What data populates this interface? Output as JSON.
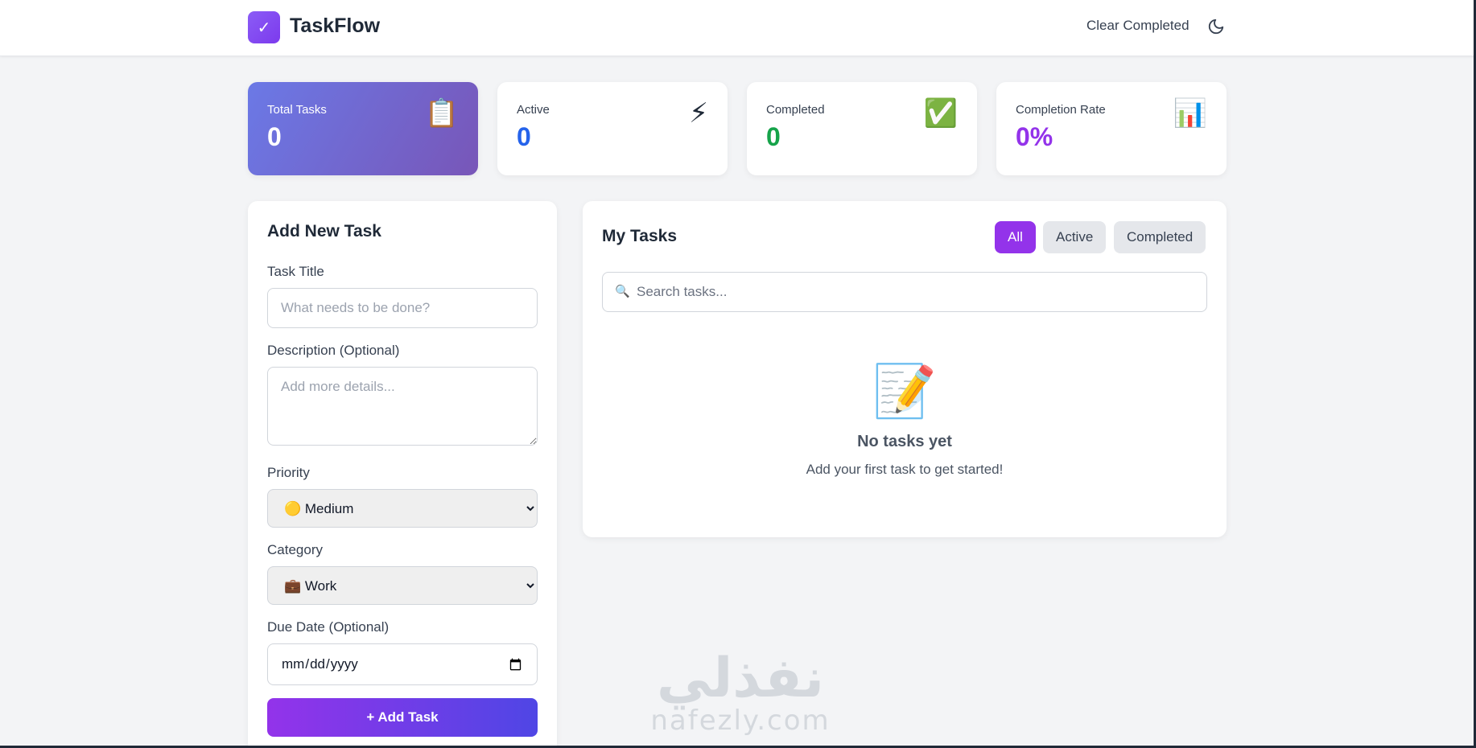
{
  "header": {
    "logo_glyph": "✓",
    "app_title": "TaskFlow",
    "clear_completed_label": "Clear Completed",
    "theme_icon": "moon-icon"
  },
  "stats": [
    {
      "label": "Total Tasks",
      "value": "0",
      "icon": "📋",
      "icon_name": "clipboard-icon",
      "value_color": "#ffffff"
    },
    {
      "label": "Active",
      "value": "0",
      "icon": "⚡",
      "icon_name": "lightning-icon",
      "value_color": "#2563eb"
    },
    {
      "label": "Completed",
      "value": "0",
      "icon": "✅",
      "icon_name": "check-mark-icon",
      "value_color": "#16a34a"
    },
    {
      "label": "Completion Rate",
      "value": "0%",
      "icon": "📊",
      "icon_name": "bar-chart-icon",
      "value_color": "#9333ea"
    }
  ],
  "add_task": {
    "title": "Add New Task",
    "task_title_label": "Task Title",
    "task_title_placeholder": "What needs to be done?",
    "description_label": "Description (Optional)",
    "description_placeholder": "Add more details...",
    "priority_label": "Priority",
    "priority_selected": "🟡 Medium",
    "category_label": "Category",
    "category_selected": "💼 Work",
    "due_date_label": "Due Date (Optional)",
    "due_date_placeholder": "mm/dd/yyyy",
    "add_button_label": "+ Add Task"
  },
  "tasks": {
    "title": "My Tasks",
    "filters": [
      {
        "label": "All",
        "active": true
      },
      {
        "label": "Active",
        "active": false
      },
      {
        "label": "Completed",
        "active": false
      }
    ],
    "search_placeholder": "Search tasks...",
    "search_icon": "🔍",
    "empty_icon": "📝",
    "empty_title": "No tasks yet",
    "empty_subtitle": "Add your first task to get started!"
  },
  "watermark": {
    "arabic": "نفذلي",
    "latin": "nafezly.com"
  },
  "colors": {
    "accent": "#9333ea",
    "background": "#f3f4f6"
  }
}
